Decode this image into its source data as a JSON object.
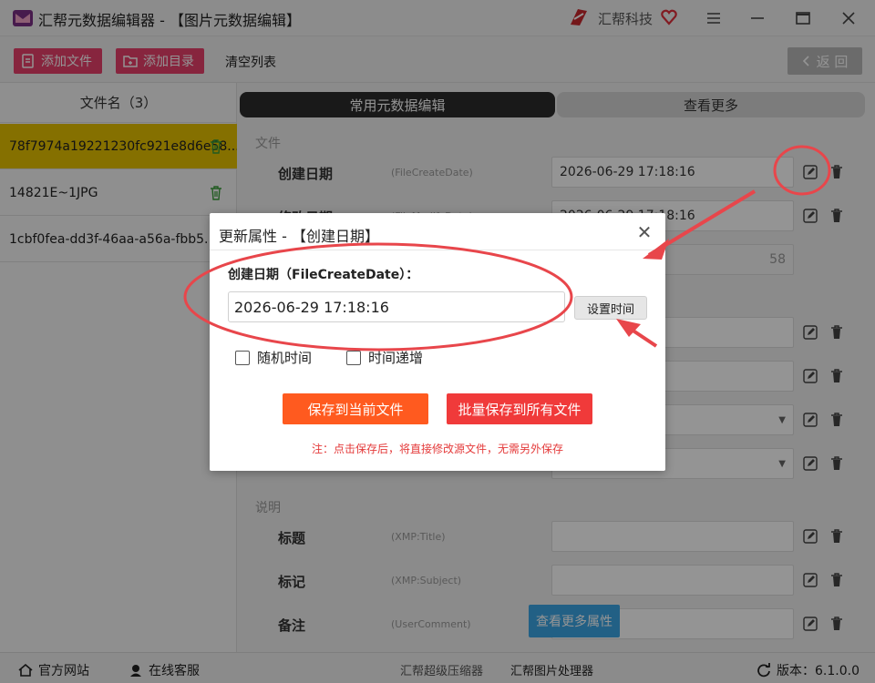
{
  "app": {
    "title": "汇帮元数据编辑器 - 【图片元数据编辑】",
    "brand": "汇帮科技"
  },
  "toolbar": {
    "add_file": "添加文件",
    "add_dir": "添加目录",
    "clear_list": "清空列表",
    "back": "返 回"
  },
  "files": {
    "header": "文件名（3）",
    "items": [
      {
        "name": "78f7974a19221230fc921e8d6e58..."
      },
      {
        "name": "14821E~1JPG"
      },
      {
        "name": "1cbf0fea-dd3f-46aa-a56a-fbb5..."
      }
    ]
  },
  "tabs": {
    "common": "常用元数据编辑",
    "more": "查看更多"
  },
  "sections": {
    "file": "文件",
    "description": "说明"
  },
  "fields": [
    {
      "label": "创建日期",
      "tag": "(FileCreateDate)",
      "value": "2026-06-29 17:18:16"
    },
    {
      "label": "修改日期",
      "tag": "(FileModifyDate)",
      "value": "2026-06-29 17:18:16"
    },
    {
      "label": "",
      "tag": "",
      "value": "58"
    }
  ],
  "desc_fields": [
    {
      "label": "标题",
      "tag": "(XMP:Title)",
      "value": ""
    },
    {
      "label": "标记",
      "tag": "(XMP:Subject)",
      "value": ""
    },
    {
      "label": "备注",
      "tag": "(UserComment)",
      "value": ""
    }
  ],
  "more_props_button": "查看更多属性",
  "dialog": {
    "title": "更新属性 - 【创建日期】",
    "field_label": "创建日期（FileCreateDate）：",
    "value": "2026-06-29 17:18:16",
    "set_time": "设置时间",
    "random_time": "随机时间",
    "time_increment": "时间递增",
    "save_current": "保存到当前文件",
    "save_all": "批量保存到所有文件",
    "note": "注：点击保存后，将直接修改源文件，无需另外保存"
  },
  "status": {
    "website": "官方网站",
    "support": "在线客服",
    "compressor": "汇帮超级压缩器",
    "image_processor": "汇帮图片处理器",
    "version": "版本：6.1.0.0"
  },
  "colors": {
    "accent_pink": "#e8416c",
    "selected_row": "#e6c200",
    "orange_button": "#ff5a1f",
    "red_button": "#f03a3a",
    "annotation_red": "#e8464b",
    "more_button_blue": "#3ba6e6"
  }
}
